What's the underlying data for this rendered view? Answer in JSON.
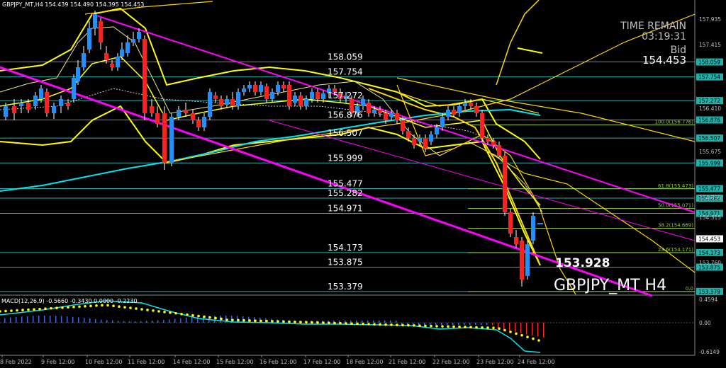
{
  "header": {
    "symbol_line": "GBPJPY_MT,H4  154.439 154.490 154.395 154.453"
  },
  "info_panel": {
    "time_label": "TIME REMAIN",
    "time_value": "03:19:31",
    "bid_label": "Bid",
    "bid_value": "154.453"
  },
  "watermark": {
    "big_price": "153.928",
    "symbol": "GBPJPY_MT H4"
  },
  "level_lines": [
    {
      "price": 158.059,
      "label": "158.059"
    },
    {
      "price": 157.754,
      "label": "157.754"
    },
    {
      "price": 157.272,
      "label": "157.272"
    },
    {
      "price": 156.876,
      "label": "156.876"
    },
    {
      "price": 156.507,
      "label": "156.507"
    },
    {
      "price": 155.999,
      "label": "155.999"
    },
    {
      "price": 155.477,
      "label": "155.477"
    },
    {
      "price": 155.282,
      "label": "155.282"
    },
    {
      "price": 154.971,
      "label": "154.971"
    },
    {
      "price": 154.173,
      "label": "154.173"
    },
    {
      "price": 153.875,
      "label": "153.875"
    },
    {
      "price": 153.379,
      "label": "153.379"
    }
  ],
  "fibo_levels": [
    {
      "price": 156.776,
      "label": "100.0(156.776)"
    },
    {
      "price": 155.473,
      "label": "61.8(155.473)"
    },
    {
      "price": 155.071,
      "label": "50.0(155.071)"
    },
    {
      "price": 154.669,
      "label": "38.2(154.669)"
    },
    {
      "price": 154.171,
      "label": "23.6(154.171)"
    },
    {
      "price": 153.379,
      "label": "0.0"
    }
  ],
  "price_axis": {
    "plain_ticks": [
      "157.935",
      "157.415",
      "156.410",
      "155.675",
      "154.895",
      "154.315",
      "153.760"
    ],
    "current_price": "154.453"
  },
  "macd": {
    "label": "MACD(12,26,9) -0.5660 -0.3430 0.0000 -0.2230",
    "axis_ticks": [
      "0.4594",
      "0.00",
      "-0.6149"
    ]
  },
  "time_axis": {
    "labels": [
      "8 Feb 2022",
      "9 Feb 12:00",
      "10 Feb 12:00",
      "11 Feb 12:00",
      "14 Feb 12:00",
      "15 Feb 12:00",
      "16 Feb 12:00",
      "17 Feb 12:00",
      "18 Feb 12:00",
      "21 Feb 12:00",
      "22 Feb 12:00",
      "23 Feb 12:00",
      "24 Feb 12:00"
    ]
  },
  "colors": {
    "background": "#000000",
    "level_line": "#20b2aa",
    "fibo_line": "#9acd32",
    "bull_candle": "#1e90ff",
    "bear_candle": "#ff2020",
    "bollinger": "#ffff00",
    "envelope": "#ffd700",
    "channel": "#ff00ff",
    "ma_cyan": "#00e5ee",
    "macd_signal": "#ffff00"
  }
}
